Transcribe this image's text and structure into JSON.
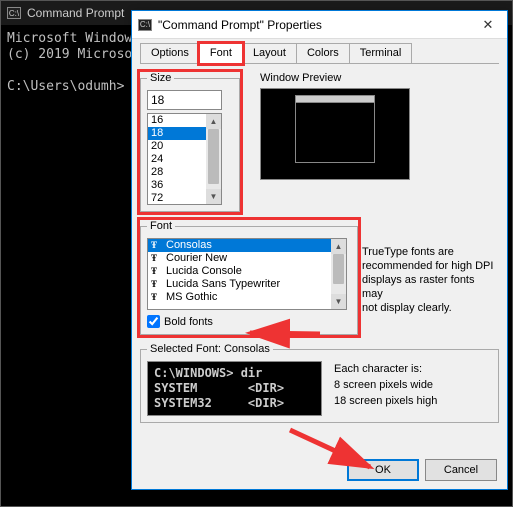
{
  "cmd_bg": {
    "title": "Command Prompt",
    "line1": "Microsoft Window",
    "line2": "(c) 2019 Microso",
    "prompt": "C:\\Users\\odumh>"
  },
  "dialog": {
    "title": "\"Command Prompt\" Properties",
    "tabs": [
      "Options",
      "Font",
      "Layout",
      "Colors",
      "Terminal"
    ],
    "active_tab": 1
  },
  "size": {
    "legend": "Size",
    "current": "18",
    "options": [
      "16",
      "18",
      "20",
      "24",
      "28",
      "36",
      "72"
    ],
    "selected": "18"
  },
  "preview": {
    "label": "Window Preview"
  },
  "font": {
    "legend": "Font",
    "options": [
      "Consolas",
      "Courier New",
      "Lucida Console",
      "Lucida Sans Typewriter",
      "MS Gothic"
    ],
    "selected": "Consolas",
    "bold_label": "Bold fonts",
    "bold_checked": true
  },
  "font_hint": {
    "l1": "TrueType fonts are",
    "l2": "recommended for high DPI",
    "l3": "displays as raster fonts may",
    "l4": "not display clearly."
  },
  "selected_font": {
    "legend": "Selected Font: Consolas",
    "sample_l1": "C:\\WINDOWS> dir",
    "sample_l2": "SYSTEM       <DIR>",
    "sample_l3": "SYSTEM32     <DIR>",
    "char_info_title": "Each character is:",
    "char_info_l1": "  8 screen pixels wide",
    "char_info_l2": " 18 screen pixels high"
  },
  "buttons": {
    "ok": "OK",
    "cancel": "Cancel"
  }
}
